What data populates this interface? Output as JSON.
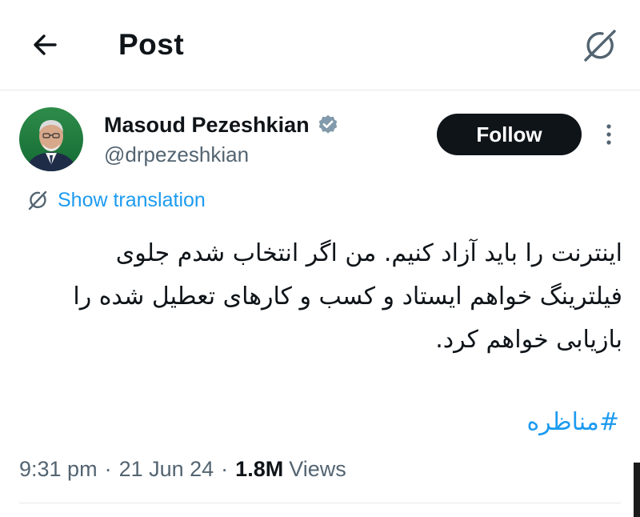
{
  "header": {
    "title": "Post",
    "back_icon": "arrow-left-icon",
    "grok_icon": "grok-icon"
  },
  "author": {
    "name": "Masoud Pezeshkian",
    "handle": "@drpezeshkian",
    "verified_icon": "verified-badge-icon",
    "verified_color": "#829aab"
  },
  "actions": {
    "follow_label": "Follow",
    "more_icon": "more-vertical-icon"
  },
  "translation": {
    "label": "Show translation",
    "icon": "translate-globe-icon"
  },
  "tweet": {
    "text": "اینترنت را باید آزاد کنیم. من اگر انتخاب شدم جلوی\nفیلترینگ خواهم ایستاد و کسب و کارهای تعطیل شده را\nبازیابی خواهم کرد.",
    "hashtag": "#مناظره"
  },
  "meta": {
    "time": "9:31 pm",
    "date": "21 Jun 24",
    "separator": "·",
    "views_count": "1.8M",
    "views_label": "Views"
  },
  "colors": {
    "accent": "#1d9bf0",
    "text_primary": "#0f1419",
    "text_secondary": "#536471",
    "follow_bg": "#0f1419"
  }
}
